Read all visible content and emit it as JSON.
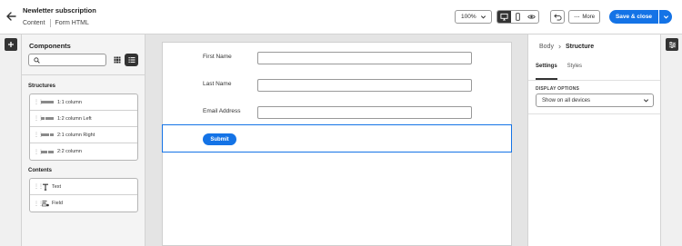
{
  "header": {
    "title": "Newletter subscription",
    "breadcrumbs": [
      "Content",
      "Form HTML"
    ],
    "zoom": "100%",
    "more_label": "More",
    "save_label": "Save & close"
  },
  "components": {
    "title": "Components",
    "search_placeholder": "",
    "structures_label": "Structures",
    "structures": [
      {
        "label": "1:1 column"
      },
      {
        "label": "1:2 column Left"
      },
      {
        "label": "2:1 column Right"
      },
      {
        "label": "2:2 column"
      }
    ],
    "contents_label": "Contents",
    "contents": [
      {
        "label": "Text",
        "icon": "text-icon"
      },
      {
        "label": "Field",
        "icon": "field-icon"
      }
    ]
  },
  "canvas": {
    "fields": [
      {
        "label": "First Name"
      },
      {
        "label": "Last Name"
      },
      {
        "label": "Email Address"
      }
    ],
    "submit_label": "Submit"
  },
  "properties": {
    "breadcrumb_parent": "Body",
    "breadcrumb_current": "Structure",
    "tabs": [
      "Settings",
      "Styles"
    ],
    "active_tab": "Settings",
    "display_options_label": "DISPLAY OPTIONS",
    "display_options_value": "Show on all devices"
  },
  "colors": {
    "accent": "#1473e6",
    "dark": "#333333"
  }
}
